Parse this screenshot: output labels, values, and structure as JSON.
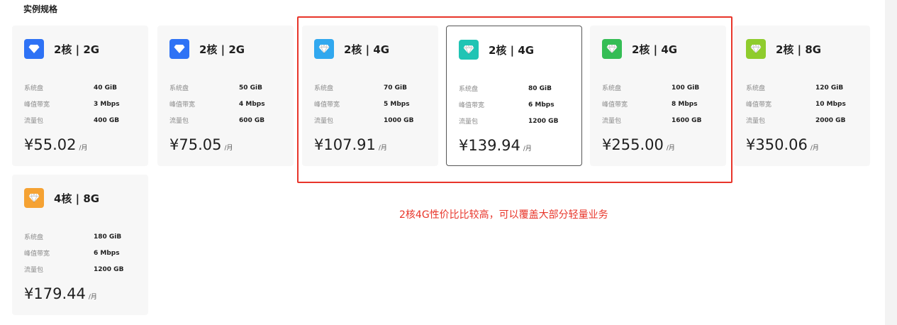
{
  "section": {
    "title": "实例规格"
  },
  "labels": {
    "disk": "系统盘",
    "bandwidth": "峰值带宽",
    "traffic": "流量包",
    "unit": "/月"
  },
  "plans": [
    {
      "title": "2核 | 2G",
      "disk": "40 GiB",
      "bandwidth": "3 Mbps",
      "traffic": "400 GB",
      "price": "¥55.02",
      "color": "#2e72f5",
      "icon": "diamond-icon"
    },
    {
      "title": "2核 | 2G",
      "disk": "50 GiB",
      "bandwidth": "4 Mbps",
      "traffic": "600 GB",
      "price": "¥75.05",
      "color": "#2e72f5",
      "icon": "diamond-icon"
    },
    {
      "title": "2核 | 4G",
      "disk": "70 GiB",
      "bandwidth": "5 Mbps",
      "traffic": "1000 GB",
      "price": "¥107.91",
      "color": "#31a8ef",
      "icon": "gem-icon"
    },
    {
      "title": "2核 | 4G",
      "disk": "80 GiB",
      "bandwidth": "6 Mbps",
      "traffic": "1200 GB",
      "price": "¥139.94",
      "color": "#20c4b4",
      "icon": "gem-icon",
      "selected": true
    },
    {
      "title": "2核 | 4G",
      "disk": "100 GiB",
      "bandwidth": "8 Mbps",
      "traffic": "1600 GB",
      "price": "¥255.00",
      "color": "#35bd55",
      "icon": "gem-icon"
    },
    {
      "title": "2核 | 8G",
      "disk": "120 GiB",
      "bandwidth": "10 Mbps",
      "traffic": "2000 GB",
      "price": "¥350.06",
      "color": "#8fcc2d",
      "icon": "gem-icon"
    },
    {
      "title": "4核 | 8G",
      "disk": "180 GiB",
      "bandwidth": "6 Mbps",
      "traffic": "1200 GB",
      "price": "¥179.44",
      "color": "#f5a233",
      "icon": "gem-icon"
    }
  ],
  "annotation": {
    "text": "2核4G性价比比较高，可以覆盖大部分轻量业务",
    "color": "#e8352a"
  }
}
